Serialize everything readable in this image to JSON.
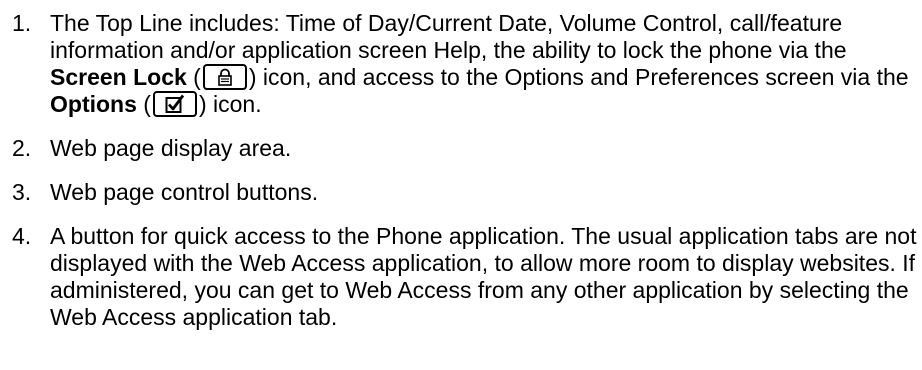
{
  "items": [
    {
      "number": "1",
      "text_a": "The Top Line includes: Time of Day/Current Date, Volume Control, call/feature information and/or application screen Help, the ability to lock the phone via the ",
      "bold_a": "Screen Lock",
      "text_b": " (",
      "icon_a": "lock-icon",
      "text_c": ") icon, and access to the Options and Preferences screen via the ",
      "bold_b": "Options",
      "text_d": " (",
      "icon_b": "checkbox-checked-icon",
      "text_e": ") icon."
    },
    {
      "number": "2",
      "text": "Web page display area."
    },
    {
      "number": "3",
      "text": "Web page control buttons."
    },
    {
      "number": "4",
      "text": "A button for quick access to the Phone application. The usual application tabs are not displayed with the Web Access application, to allow more room to display websites. If administered, you can get to Web Access from any other application by selecting the Web Access application tab."
    }
  ]
}
